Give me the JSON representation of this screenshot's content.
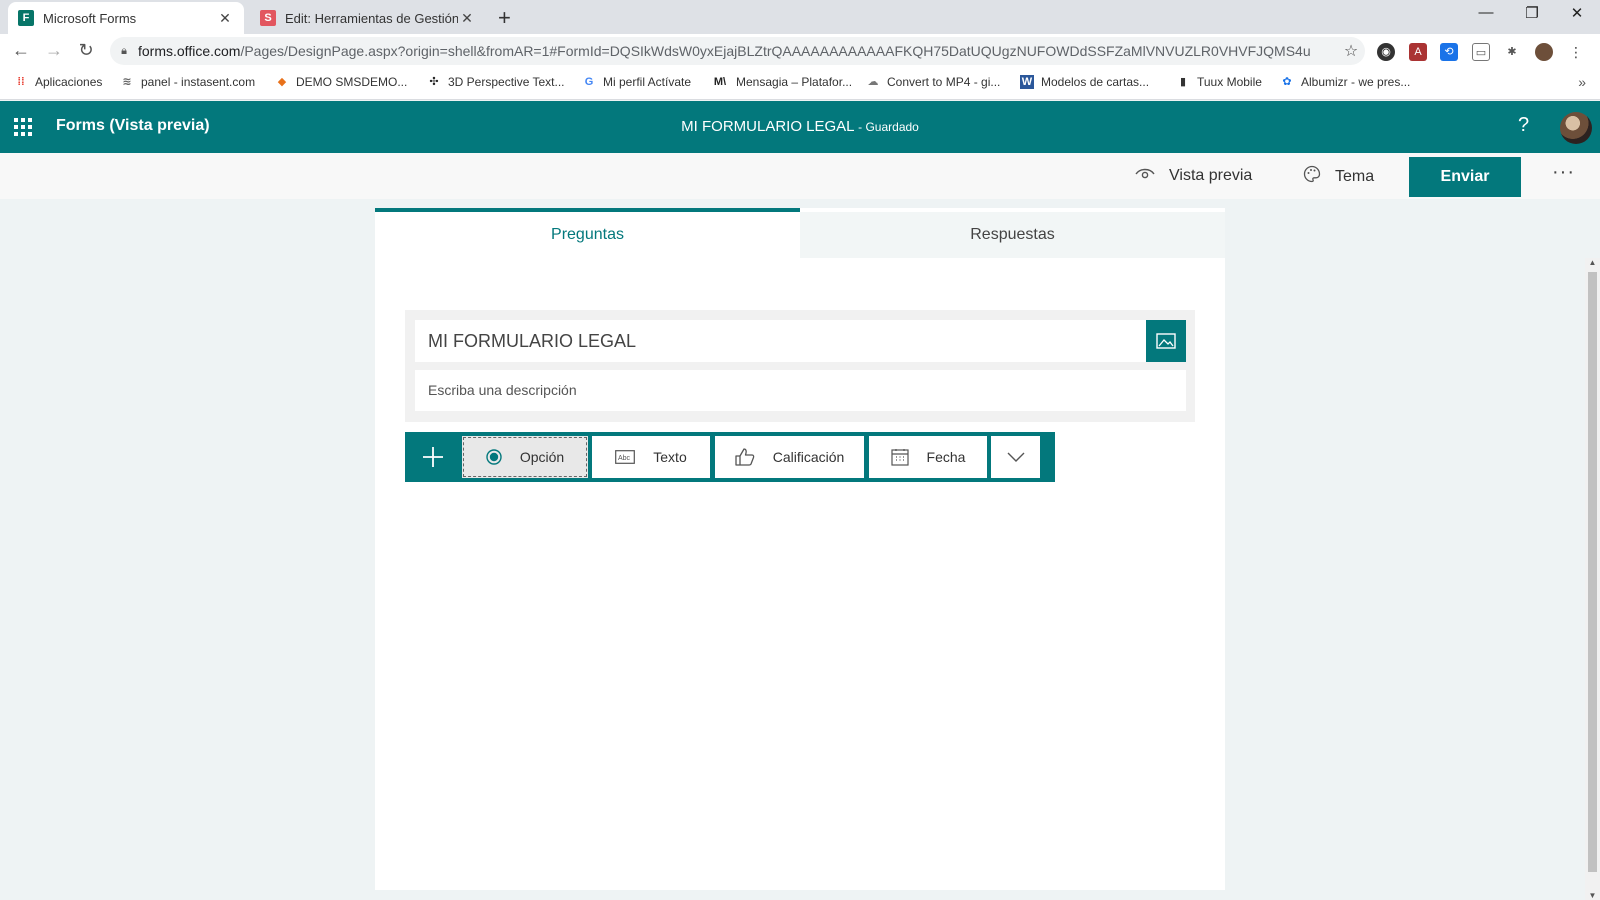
{
  "browser": {
    "tabs": [
      {
        "title": "Microsoft Forms",
        "favicon": "F",
        "favicon_color": "#077568",
        "active": true
      },
      {
        "title": "Edit: Herramientas de Gestión Di",
        "favicon": "S",
        "favicon_color": "#e2565f",
        "active": false
      }
    ],
    "url_domain": "forms.office.com",
    "url_path": "/Pages/DesignPage.aspx?origin=shell&fromAR=1#FormId=DQSIkWdsW0yxEjajBLZtrQAAAAAAAAAAAAFKQH75DatUQUgzNUFOWDdSSFZaMlVNVUZLR0VHVFJQMS4u",
    "bookmarks": [
      {
        "label": "Aplicaciones",
        "icon": "apps-grid-icon"
      },
      {
        "label": "panel - instasent.com",
        "icon": "instasent-icon"
      },
      {
        "label": "DEMO SMSDEMO...",
        "icon": "demo-icon"
      },
      {
        "label": "3D Perspective Text...",
        "icon": "perspective-icon"
      },
      {
        "label": "Mi perfil Actívate",
        "icon": "google-icon"
      },
      {
        "label": "Mensagia – Platafor...",
        "icon": "mensagia-icon"
      },
      {
        "label": "Convert to MP4 - gi...",
        "icon": "cloud-icon"
      },
      {
        "label": "Modelos de cartas...",
        "icon": "word-icon"
      },
      {
        "label": "Tuux Mobile",
        "icon": "tuux-icon"
      },
      {
        "label": "Albumizr - we pres...",
        "icon": "albumizr-icon"
      }
    ]
  },
  "app": {
    "name": "Forms (Vista previa)",
    "form_title": "MI FORMULARIO LEGAL",
    "saved_status": "- Guardado",
    "help": "?"
  },
  "commands": {
    "preview": "Vista previa",
    "theme": "Tema",
    "send": "Enviar",
    "more": "···"
  },
  "tabs": {
    "questions": "Preguntas",
    "responses": "Respuestas"
  },
  "form": {
    "title": "MI FORMULARIO LEGAL",
    "description_placeholder": "Escriba una descripción"
  },
  "question_types": [
    {
      "label": "Opción",
      "icon": "radio-icon"
    },
    {
      "label": "Texto",
      "icon": "text-abc-icon"
    },
    {
      "label": "Calificación",
      "icon": "thumbs-up-icon"
    },
    {
      "label": "Fecha",
      "icon": "calendar-icon"
    }
  ],
  "colors": {
    "brand": "#03787c",
    "page_bg": "#eef3f4"
  }
}
